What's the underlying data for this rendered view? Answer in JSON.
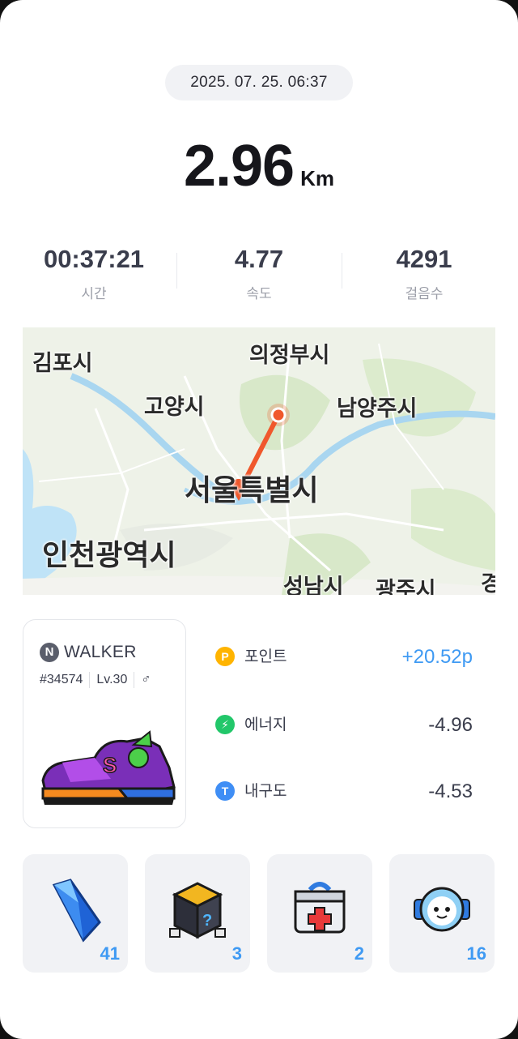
{
  "header": {
    "datetime": "2025. 07. 25. 06:37"
  },
  "summary": {
    "distance_value": "2.96",
    "distance_unit": "Km"
  },
  "stats": [
    {
      "value": "00:37:21",
      "label": "시간"
    },
    {
      "value": "4.77",
      "label": "속도"
    },
    {
      "value": "4291",
      "label": "걸음수"
    }
  ],
  "map": {
    "cities": [
      "김포시",
      "의정부시",
      "고양시",
      "남양주시",
      "서울특별시",
      "인천광역시",
      "성남시",
      "광주시",
      "경"
    ],
    "route_color": "#f0582c"
  },
  "nft_card": {
    "brand_letter": "N",
    "brand_name": "WALKER",
    "id": "#34574",
    "level": "Lv.30",
    "gender_symbol": "♂"
  },
  "rewards": [
    {
      "icon": "point-coin-icon",
      "icon_glyph": "P",
      "label": "포인트",
      "amount": "+20.52p",
      "color": "#ffb400",
      "amount_color": "#3f9af3"
    },
    {
      "icon": "energy-bolt-icon",
      "icon_glyph": "⚡",
      "label": "에너지",
      "amount": "-4.96",
      "color": "#22c76a",
      "amount_color": "#3a3d4c"
    },
    {
      "icon": "durability-icon",
      "icon_glyph": "T",
      "label": "내구도",
      "amount": "-4.53",
      "color": "#3f8ef5",
      "amount_color": "#3a3d4c"
    }
  ],
  "items": [
    {
      "icon": "blue-gem-icon",
      "count": "41"
    },
    {
      "icon": "mystery-box-icon",
      "count": "3"
    },
    {
      "icon": "repair-kit-icon",
      "count": "2"
    },
    {
      "icon": "robot-head-icon",
      "count": "16"
    }
  ]
}
